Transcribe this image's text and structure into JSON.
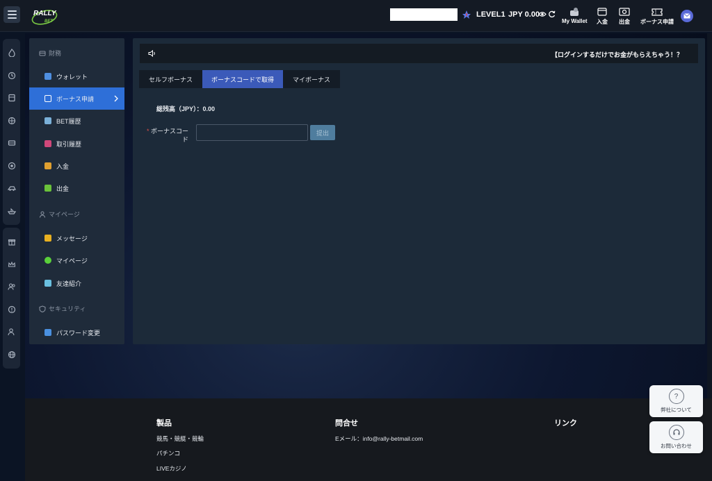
{
  "header": {
    "logo_top": "RALLY",
    "logo_bottom": "BET",
    "level": "LEVEL1",
    "currency": "JPY",
    "balance": "0.00",
    "actions": [
      {
        "label": "My Wallet",
        "icon": "wallet-icon"
      },
      {
        "label": "入金",
        "icon": "deposit-icon"
      },
      {
        "label": "出金",
        "icon": "withdraw-icon"
      },
      {
        "label": "ボーナス申請",
        "icon": "bonus-ticket-icon"
      }
    ]
  },
  "sidebar": {
    "sections": [
      {
        "label": "財務",
        "icon": "finance-icon"
      },
      {
        "label": "マイページ",
        "icon": "user-icon"
      },
      {
        "label": "セキュリティ",
        "icon": "shield-icon"
      }
    ],
    "items": [
      {
        "label": "ウォレット",
        "icon": "wallet-icon",
        "color": "#4f8fe0"
      },
      {
        "label": "ボーナス申請",
        "icon": "bonus-icon",
        "color": "#e6e9ee"
      },
      {
        "label": "BET履歴",
        "icon": "bet-history-icon",
        "color": "#7ab0d8"
      },
      {
        "label": "取引履歴",
        "icon": "transaction-icon",
        "color": "#d0487a"
      },
      {
        "label": "入金",
        "icon": "deposit-icon",
        "color": "#e0a030"
      },
      {
        "label": "出金",
        "icon": "withdraw-icon",
        "color": "#6ac23a"
      },
      {
        "label": "メッセージ",
        "icon": "mail-icon",
        "color": "#e8b020"
      },
      {
        "label": "マイページ",
        "icon": "person-icon",
        "color": "#5ad03a"
      },
      {
        "label": "友達紹介",
        "icon": "friend-icon",
        "color": "#6ac0e0"
      },
      {
        "label": "パスワード変更",
        "icon": "lock-icon",
        "color": "#4a90e0"
      }
    ]
  },
  "main": {
    "notice": "【ログインするだけでお金がもらえちゃう！？",
    "tabs": [
      "セルフボーナス",
      "ボーナスコードで取得",
      "マイボーナス"
    ],
    "total": "総残高（JPY）：0.00",
    "code_label_mark": "*",
    "code_label": "ボーナスコード",
    "code_value": "",
    "submit_label": "提出"
  },
  "footer": {
    "col1_title": "製品",
    "col1_links": [
      "競馬・競艇・競輪",
      "パチンコ",
      "LIVEカジノ"
    ],
    "col2_title": "問合せ",
    "col2_email": "Eメール：info@rally-betmail.com",
    "col3_title": "リンク"
  },
  "float_buttons": [
    {
      "label": "弊社について",
      "icon": "question-icon"
    },
    {
      "label": "お問い合わせ",
      "icon": "headset-icon"
    }
  ],
  "colors": {
    "accent": "#2e6fd8",
    "tab_active": "#3b5ab9",
    "panel": "#1c2a39",
    "sidebar": "#1f2b3a"
  }
}
